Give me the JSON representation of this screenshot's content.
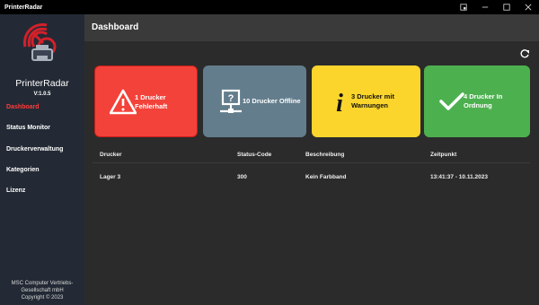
{
  "window": {
    "title": "PrinterRadar"
  },
  "sidebar": {
    "brand": "PrinterRadar",
    "version": "V:1.0.5",
    "items": [
      {
        "label": "Dashboard",
        "active": true
      },
      {
        "label": "Status Monitor"
      },
      {
        "label": "Druckerverwaltung"
      },
      {
        "label": "Kategorien"
      },
      {
        "label": "Lizenz"
      }
    ],
    "footer": [
      "MSC Computer Vertriebs-",
      "Gesellschaft mbH",
      "Copyright © 2023"
    ]
  },
  "header": {
    "title": "Dashboard"
  },
  "cards": [
    {
      "label": "1 Drucker Fehlerhaft",
      "line1": "1 Drucker",
      "line2": "Fehlerhaft",
      "icon": "warning-icon",
      "color": "#f3423a"
    },
    {
      "label": "10 Drucker Offline",
      "line1": "10 Drucker Offline",
      "line2": "",
      "icon": "network-offline-icon",
      "color": "#637d8c"
    },
    {
      "label": "3 Drucker mit Warnungen",
      "line1": "3 Drucker mit",
      "line2": "Warnungen",
      "icon": "info-icon",
      "color": "#fbd52c"
    },
    {
      "label": "4 Drucker In Ordnung",
      "line1": "4 Drucker In",
      "line2": "Ordnung",
      "icon": "checkmark-icon",
      "color": "#4db04f"
    }
  ],
  "table": {
    "columns": [
      "Drucker",
      "Status-Code",
      "Beschreibung",
      "Zeitpunkt"
    ],
    "rows": [
      [
        "Lager 3",
        "300",
        "Kein Farbband",
        "13:41:37 - 10.11.2023"
      ]
    ]
  }
}
